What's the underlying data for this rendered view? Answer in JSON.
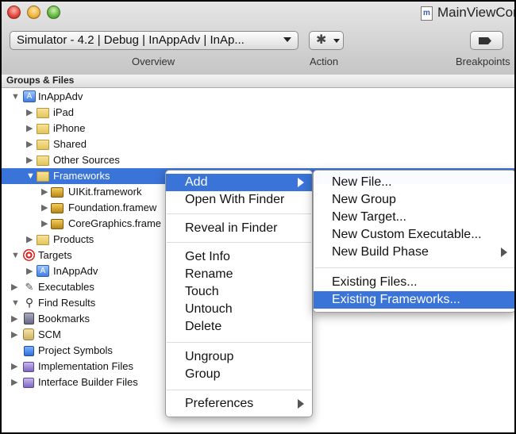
{
  "window": {
    "title": "MainViewCor",
    "doc_icon": "m"
  },
  "toolbar": {
    "scheme": "Simulator - 4.2 | Debug | InAppAdv | InAp...",
    "overview_label": "Overview",
    "action_label": "Action",
    "breakpoints_label": "Breakpoints",
    "gear_glyph": "✱"
  },
  "groups_header": "Groups & Files",
  "tree": {
    "project": "InAppAdv",
    "ipad": "iPad",
    "iphone": "iPhone",
    "shared": "Shared",
    "other_sources": "Other Sources",
    "frameworks": "Frameworks",
    "uikit": "UIKit.framework",
    "foundation": "Foundation.framew",
    "coregraphics": "CoreGraphics.frame",
    "products": "Products",
    "targets": "Targets",
    "target_inappadv": "InAppAdv",
    "executables": "Executables",
    "find_results": "Find Results",
    "bookmarks": "Bookmarks",
    "scm": "SCM",
    "project_symbols": "Project Symbols",
    "implementation_files": "Implementation Files",
    "interface_builder_files": "Interface Builder Files"
  },
  "context_menu": {
    "add": "Add",
    "open_with_finder": "Open With Finder",
    "reveal_in_finder": "Reveal in Finder",
    "get_info": "Get Info",
    "rename": "Rename",
    "touch": "Touch",
    "untouch": "Untouch",
    "delete": "Delete",
    "ungroup": "Ungroup",
    "group": "Group",
    "preferences": "Preferences"
  },
  "add_submenu": {
    "new_file": "New File...",
    "new_group": "New Group",
    "new_target": "New Target...",
    "new_custom_executable": "New Custom Executable...",
    "new_build_phase": "New Build Phase",
    "existing_files": "Existing Files...",
    "existing_frameworks": "Existing Frameworks..."
  },
  "colors": {
    "selection": "#3a74d8",
    "folder": "#e2c45a"
  }
}
